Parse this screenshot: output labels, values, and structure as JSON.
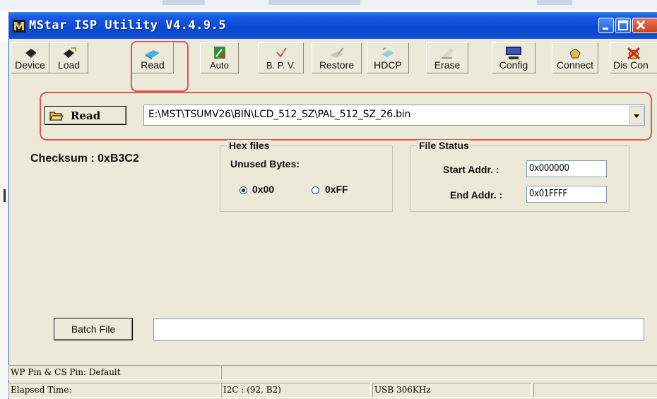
{
  "window": {
    "title": "MStar ISP Utility V4.4.9.5"
  },
  "toolbar": {
    "items": [
      {
        "label": "Device",
        "icon": "chip-icon"
      },
      {
        "label": "Load",
        "icon": "chip-load-icon"
      },
      {
        "label": "Read",
        "icon": "read-icon"
      },
      {
        "label": "Auto",
        "icon": "auto-icon"
      },
      {
        "label": "B. P. V.",
        "icon": "check-icon"
      },
      {
        "label": "Restore",
        "icon": "restore-icon"
      },
      {
        "label": "HDCP",
        "icon": "hdcp-icon"
      },
      {
        "label": "Erase",
        "icon": "erase-icon"
      },
      {
        "label": "Config",
        "icon": "monitor-icon"
      },
      {
        "label": "Connect",
        "icon": "connect-icon"
      },
      {
        "label": "Dis Con",
        "icon": "disconnect-icon"
      }
    ]
  },
  "read": {
    "button_label": "Read",
    "file_path": "E:\\MST\\TSUMV26\\BIN\\LCD_512_SZ\\PAL_512_SZ_26.bin"
  },
  "checksum": "Checksum : 0xB3C2",
  "hex_files": {
    "title": "Hex files",
    "unused_bytes_label": "Unused Bytes:",
    "option_00": "0x00",
    "option_ff": "0xFF",
    "selected": "0x00"
  },
  "file_status": {
    "title": "File Status",
    "start_label": "Start Addr. :",
    "start_value": "0x000000",
    "end_label": "End Addr. :",
    "end_value": "0x01FFFF"
  },
  "batch": {
    "button_label": "Batch File",
    "value": ""
  },
  "status_bar": {
    "wp_pin": "WP Pin & CS Pin: Default",
    "elapsed": "Elapsed Time:",
    "i2c": "I2C :  (92,  B2)",
    "usb": "USB  306KHz"
  },
  "colors": {
    "titlebar": "#0a4ad4",
    "window_bg": "#ece9d8",
    "annotation": "#e05555"
  }
}
